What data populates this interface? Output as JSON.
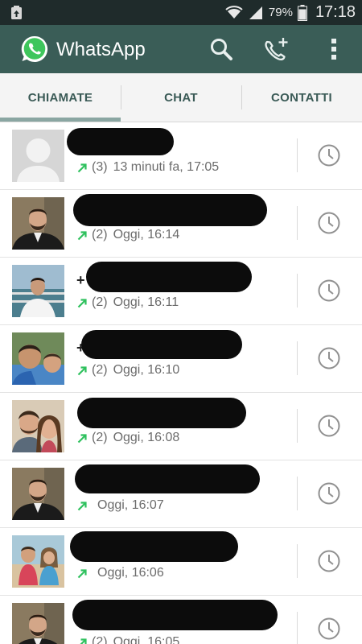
{
  "status_bar": {
    "battery": "79%",
    "time": "17:18",
    "icons": [
      "recycle-icon",
      "wifi-icon",
      "signal-icon",
      "battery-icon"
    ]
  },
  "app_bar": {
    "title": "WhatsApp",
    "logo": "whatsapp-logo",
    "actions": [
      "search-icon",
      "add-call-icon",
      "overflow-menu-icon"
    ]
  },
  "tabs": [
    {
      "label": "CHIAMATE",
      "selected": true
    },
    {
      "label": "CHAT",
      "selected": false
    },
    {
      "label": "CONTATTI",
      "selected": false
    }
  ],
  "calls": [
    {
      "count": "(3)",
      "time": "13 minuti fa, 17:05",
      "avatar": "default",
      "name_peek": ""
    },
    {
      "count": "(2)",
      "time": "Oggi, 16:14",
      "avatar": "man-beard",
      "name_peek": ""
    },
    {
      "count": "(2)",
      "time": "Oggi, 16:11",
      "avatar": "man-outdoor",
      "name_peek": "+"
    },
    {
      "count": "(2)",
      "time": "Oggi, 16:10",
      "avatar": "kids-group",
      "name_peek": "+"
    },
    {
      "count": "(2)",
      "time": "Oggi, 16:08",
      "avatar": "couple",
      "name_peek": ""
    },
    {
      "count": "",
      "time": "Oggi, 16:07",
      "avatar": "man-beard",
      "name_peek": ""
    },
    {
      "count": "",
      "time": "Oggi, 16:06",
      "avatar": "kids-beach",
      "name_peek": ""
    },
    {
      "count": "(2)",
      "time": "Oggi, 16:05",
      "avatar": "man-beard",
      "name_peek": ""
    }
  ],
  "colors": {
    "status_bar": "#1f2b2b",
    "app_bar": "#3a5d57",
    "tab_text": "#3a5a56",
    "outgoing_arrow": "#2fc15e",
    "meta_text": "#6c6c6c"
  }
}
